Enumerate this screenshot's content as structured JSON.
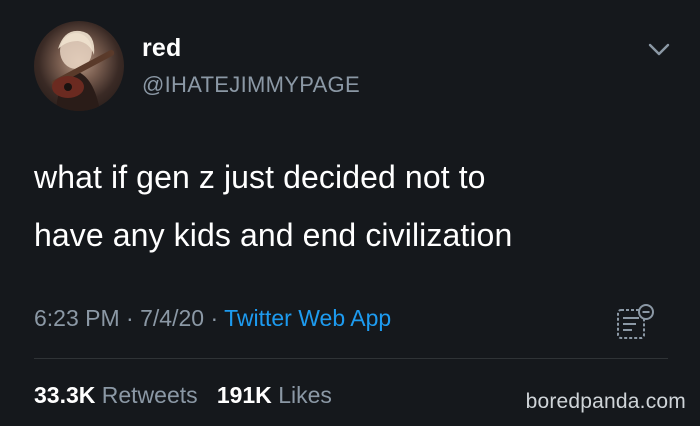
{
  "tweet": {
    "display_name": "red",
    "handle": "@IHATEJIMMYPAGE",
    "text_lines": [
      "what if gen z just decided not to",
      "have any kids and end civilization"
    ],
    "time": "6:23 PM",
    "date": "7/4/20",
    "separator": "·",
    "source": "Twitter Web App",
    "retweets_count": "33.3K",
    "retweets_label": "Retweets",
    "likes_count": "191K",
    "likes_label": "Likes"
  },
  "icons": {
    "more": "chevron-down-icon",
    "analytics": "analytics-icon",
    "avatar": "avatar-photo"
  },
  "watermark": "boredpanda.com",
  "colors": {
    "background": "#15181c",
    "primary_text": "#ffffff",
    "secondary_text": "#8b98a5",
    "link": "#1d9bf0",
    "divider": "#2f3336"
  }
}
